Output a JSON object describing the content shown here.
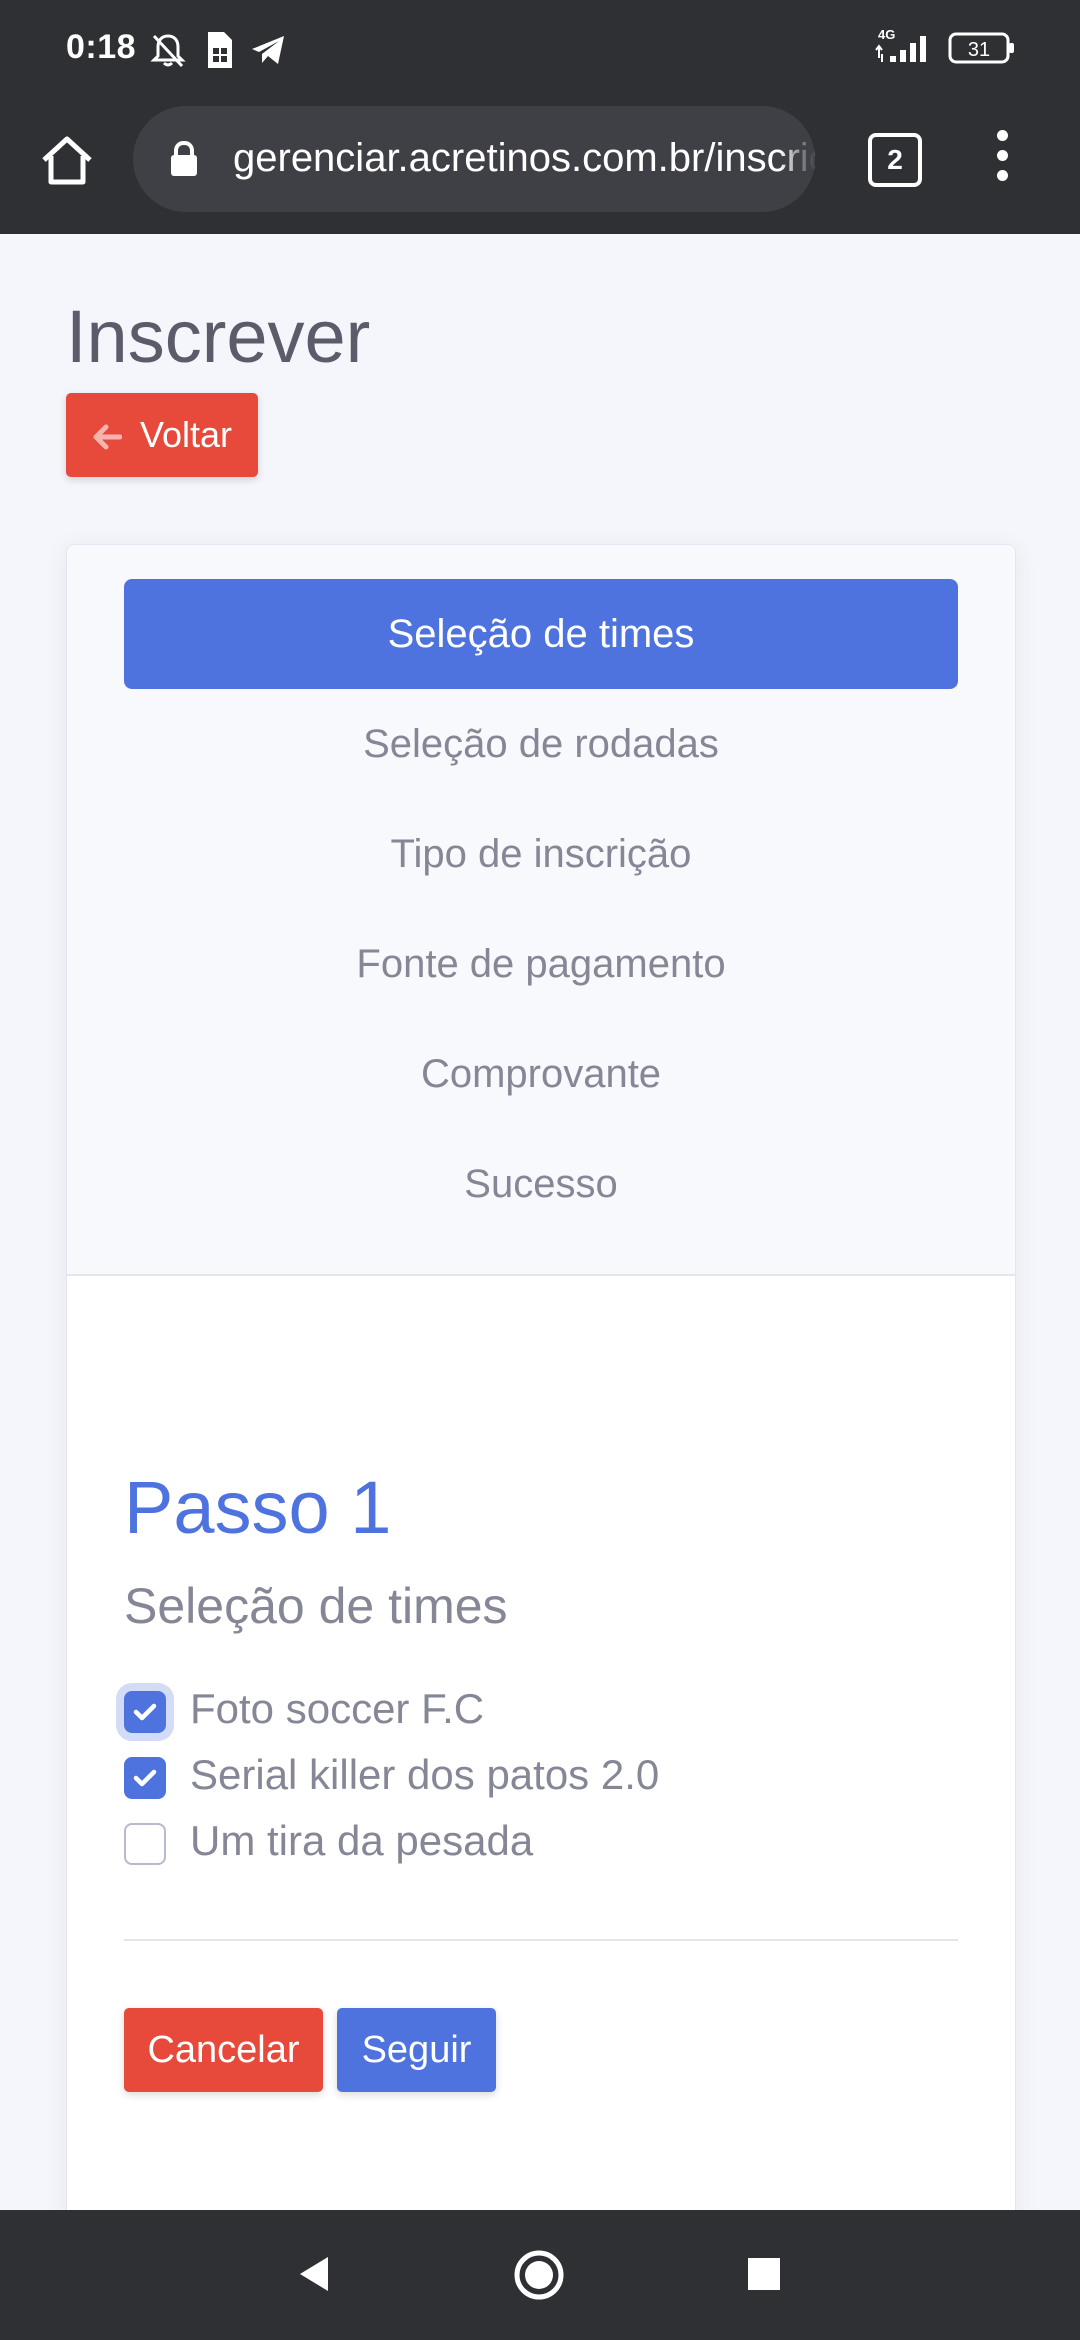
{
  "status_bar": {
    "time": "0:18",
    "network": "4G",
    "battery": "31"
  },
  "browser": {
    "url": "gerenciar.acretinos.com.br/inscricao",
    "tab_count": "2"
  },
  "page": {
    "title": "Inscrever",
    "back_button": "Voltar"
  },
  "wizard": {
    "steps": [
      {
        "label": "Seleção de times",
        "active": true
      },
      {
        "label": "Seleção de rodadas",
        "active": false
      },
      {
        "label": "Tipo de inscrição",
        "active": false
      },
      {
        "label": "Fonte de pagamento",
        "active": false
      },
      {
        "label": "Comprovante",
        "active": false
      },
      {
        "label": "Sucesso",
        "active": false
      }
    ],
    "current_step_title": "Passo 1",
    "current_step_subtitle": "Seleção de times",
    "teams": [
      {
        "label": "Foto soccer F.C",
        "checked": true
      },
      {
        "label": "Serial killer dos patos 2.0",
        "checked": true
      },
      {
        "label": "Um tira da pesada",
        "checked": false
      }
    ],
    "cancel_button": "Cancelar",
    "next_button": "Seguir"
  },
  "colors": {
    "primary": "#4e73df",
    "danger": "#e74a3b",
    "system_bar": "#2f3034"
  }
}
